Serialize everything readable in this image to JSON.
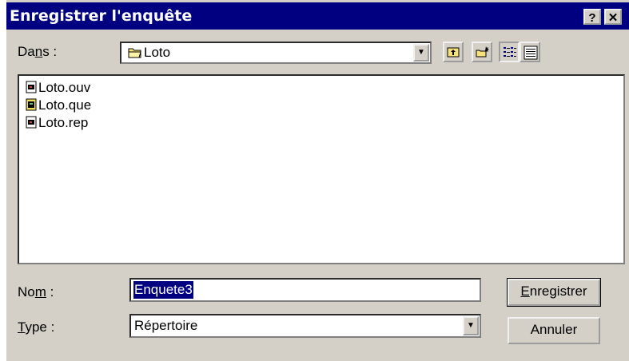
{
  "window": {
    "title": "Enregistrer l'enquête",
    "help_label": "?",
    "close_label": "✕"
  },
  "location": {
    "label_pre": "Da",
    "label_accel": "n",
    "label_post": "s :",
    "value": "Loto"
  },
  "files": [
    {
      "name": "Loto.ouv",
      "icon": "document-icon"
    },
    {
      "name": "Loto.que",
      "icon": "questionnaire-icon"
    },
    {
      "name": "Loto.rep",
      "icon": "document-icon"
    }
  ],
  "filename": {
    "label_pre": "No",
    "label_accel": "m",
    "label_post": " :",
    "value": "Enquete3"
  },
  "filetype": {
    "label_accel": "T",
    "label_post": "ype :",
    "value": "Répertoire"
  },
  "buttons": {
    "save_accel": "E",
    "save_rest": "nregistrer",
    "cancel": "Annuler"
  },
  "colors": {
    "titlebar": "#000080",
    "selection": "#000080",
    "face": "#d4d0c8"
  }
}
